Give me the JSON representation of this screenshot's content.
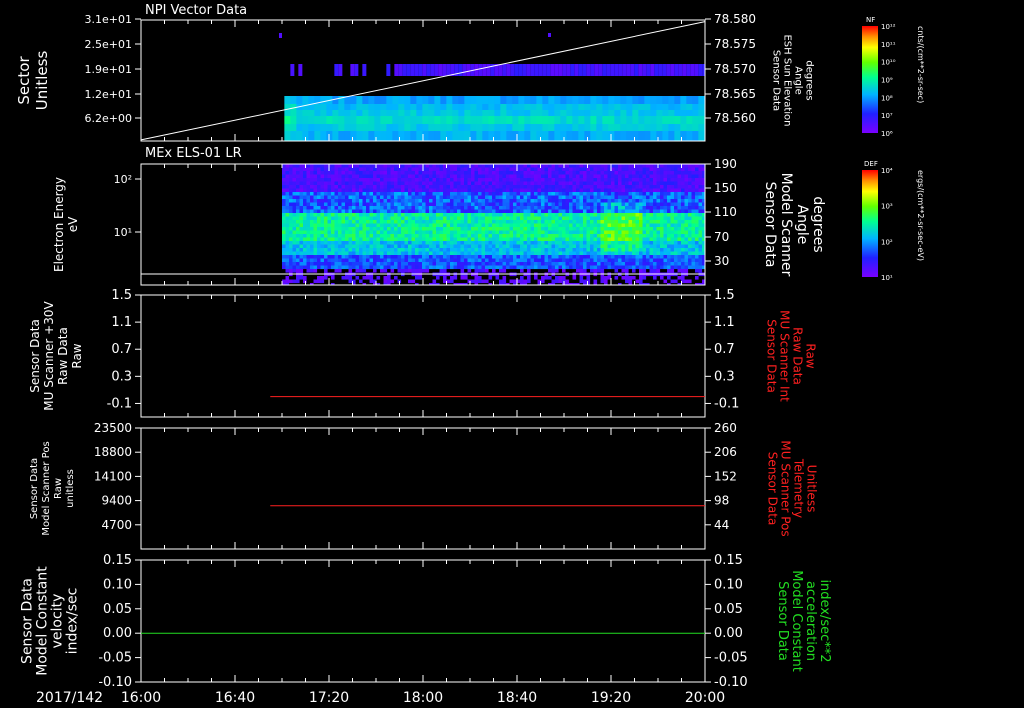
{
  "figure": {
    "date_label": "2017/142",
    "time_ticks": [
      "16:00",
      "16:40",
      "17:20",
      "18:00",
      "18:40",
      "19:20",
      "20:00"
    ]
  },
  "colorbars": [
    {
      "title": "NF",
      "unit": "cnts/(cm**2-sr-sec)",
      "tick_labels": [
        "10¹²",
        "10¹¹",
        "10¹⁰",
        "10⁹",
        "10⁸",
        "10⁷",
        "10⁶"
      ]
    },
    {
      "title": "DEF",
      "unit": "ergs/(cm**2-sr-sec-eV)",
      "tick_labels": [
        "10⁴",
        "10³",
        "10²",
        "10¹"
      ]
    }
  ],
  "colors": {
    "background": "#000000",
    "axes": "#ffffff",
    "red_trace": "#ff2020",
    "green_trace": "#22dd22"
  },
  "chart_data": [
    {
      "type": "heatmap",
      "title": "NPI Vector Data",
      "ylabel": [
        "Sector",
        "Unitless"
      ],
      "y_ticks": [
        "3.1e+01",
        "2.5e+01",
        "1.9e+01",
        "1.2e+01",
        "6.2e+00"
      ],
      "y2label": [
        "Sensor Data",
        "ESH Sun Elevation",
        "Angle",
        "degrees"
      ],
      "y2_ticks": [
        "78.580",
        "78.575",
        "78.570",
        "78.565",
        "78.560"
      ],
      "y2lim": [
        78.5575,
        78.58
      ],
      "overlay_line": {
        "x": [
          "16:00",
          "20:00"
        ],
        "y": [
          78.5577,
          78.5797
        ]
      },
      "data_start": "17:01",
      "colorbar": "NF"
    },
    {
      "type": "heatmap",
      "title": "MEx ELS-01 LR",
      "ylabel": [
        "Electron Energy",
        "eV"
      ],
      "y_ticks": [
        "10²",
        "10¹"
      ],
      "y2label": [
        "Sensor Data",
        "Model Scanner",
        "Angle",
        "degrees"
      ],
      "y2_ticks": [
        "190",
        "150",
        "110",
        "70",
        "30"
      ],
      "y2lim": [
        10,
        190
      ],
      "overlay_line": {
        "x": [
          "16:00",
          "20:00"
        ],
        "y": [
          10,
          10
        ]
      },
      "data_start": "17:00",
      "colorbar": "DEF"
    },
    {
      "type": "line",
      "ylabel": [
        "Sensor Data",
        "MU Scanner +30V",
        "Raw Data",
        "Raw"
      ],
      "y_ticks": [
        "1.5",
        "1.1",
        "0.7",
        "0.3",
        "-0.1"
      ],
      "ylim": [
        -0.3,
        1.5
      ],
      "y2label": [
        "Sensor Data",
        "MU Scanner Int",
        "Raw Data",
        "Raw"
      ],
      "y2_ticks": [
        "1.5",
        "1.1",
        "0.7",
        "0.3",
        "-0.1"
      ],
      "series": [
        {
          "x": [
            "16:55",
            "20:00"
          ],
          "values": [
            0.0,
            0.0
          ]
        }
      ]
    },
    {
      "type": "line",
      "ylabel": [
        "Sensor Data",
        "Model Scanner Pos",
        "Raw",
        "unitless"
      ],
      "y_ticks": [
        "23500",
        "18800",
        "14100",
        "9400",
        "4700"
      ],
      "ylim": [
        0,
        23500
      ],
      "y2label": [
        "Sensor Data",
        "MU Scanner Pos",
        "Telemetry",
        "Unitless"
      ],
      "y2_ticks": [
        "260",
        "206",
        "152",
        "98",
        "44"
      ],
      "series": [
        {
          "x": [
            "16:55",
            "20:00"
          ],
          "values": [
            8400,
            8400
          ]
        }
      ]
    },
    {
      "type": "line",
      "ylabel": [
        "Sensor Data",
        "Model Constant",
        "velocity",
        "index/sec"
      ],
      "y_ticks": [
        "0.15",
        "0.10",
        "0.05",
        "0.00",
        "-0.05",
        "-0.10"
      ],
      "ylim": [
        -0.1,
        0.15
      ],
      "y2label": [
        "Sensor Data",
        "Model Constant",
        "acceleration",
        "index/sec**2"
      ],
      "y2_ticks": [
        "0.15",
        "0.10",
        "0.05",
        "0.00",
        "-0.05",
        "-0.10"
      ],
      "series": [
        {
          "x": [
            "16:00",
            "20:00"
          ],
          "values": [
            0.0,
            0.0
          ]
        }
      ]
    }
  ]
}
